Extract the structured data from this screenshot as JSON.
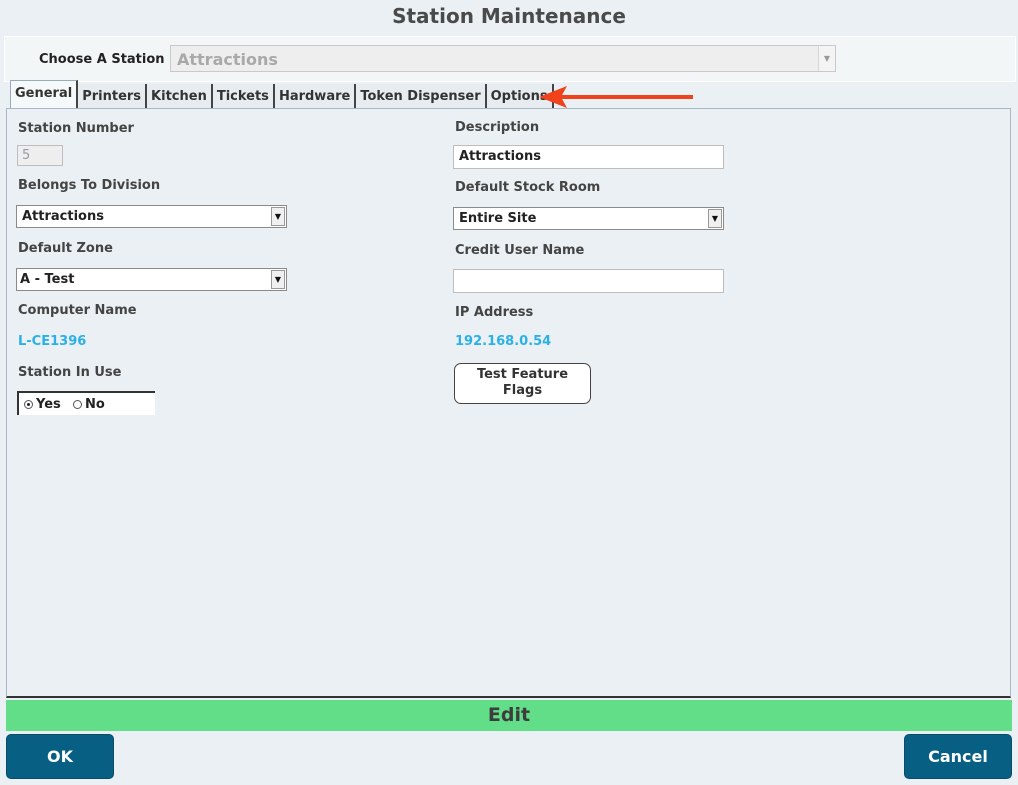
{
  "window": {
    "title": "Station Maintenance"
  },
  "station_chooser": {
    "label": "Choose A Station",
    "value": "Attractions"
  },
  "tabs": [
    {
      "label": "General",
      "active": true
    },
    {
      "label": "Printers"
    },
    {
      "label": "Kitchen"
    },
    {
      "label": "Tickets"
    },
    {
      "label": "Hardware"
    },
    {
      "label": "Token Dispenser"
    },
    {
      "label": "Options"
    }
  ],
  "general": {
    "station_number": {
      "label": "Station Number",
      "value": "5"
    },
    "division": {
      "label": "Belongs To Division",
      "value": "Attractions"
    },
    "zone": {
      "label": "Default Zone",
      "value": "A - Test"
    },
    "computer_name": {
      "label": "Computer Name",
      "value": "L-CE1396"
    },
    "station_in_use": {
      "label": "Station In Use",
      "yes": "Yes",
      "no": "No",
      "selected": "Yes"
    },
    "description": {
      "label": "Description",
      "value": "Attractions"
    },
    "stock_room": {
      "label": "Default Stock Room",
      "value": "Entire Site"
    },
    "credit_user": {
      "label": "Credit User Name",
      "value": ""
    },
    "ip_address": {
      "label": "IP Address",
      "value": "192.168.0.54"
    },
    "test_button": {
      "line1": "Test Feature",
      "line2": "Flags"
    }
  },
  "mode": {
    "label": "Edit",
    "color": "#61de87"
  },
  "footer": {
    "ok": "OK",
    "cancel": "Cancel"
  },
  "colors": {
    "accent": "#085f84",
    "info_text": "#2bb0e8",
    "annotation_arrow": "#f0431c"
  }
}
